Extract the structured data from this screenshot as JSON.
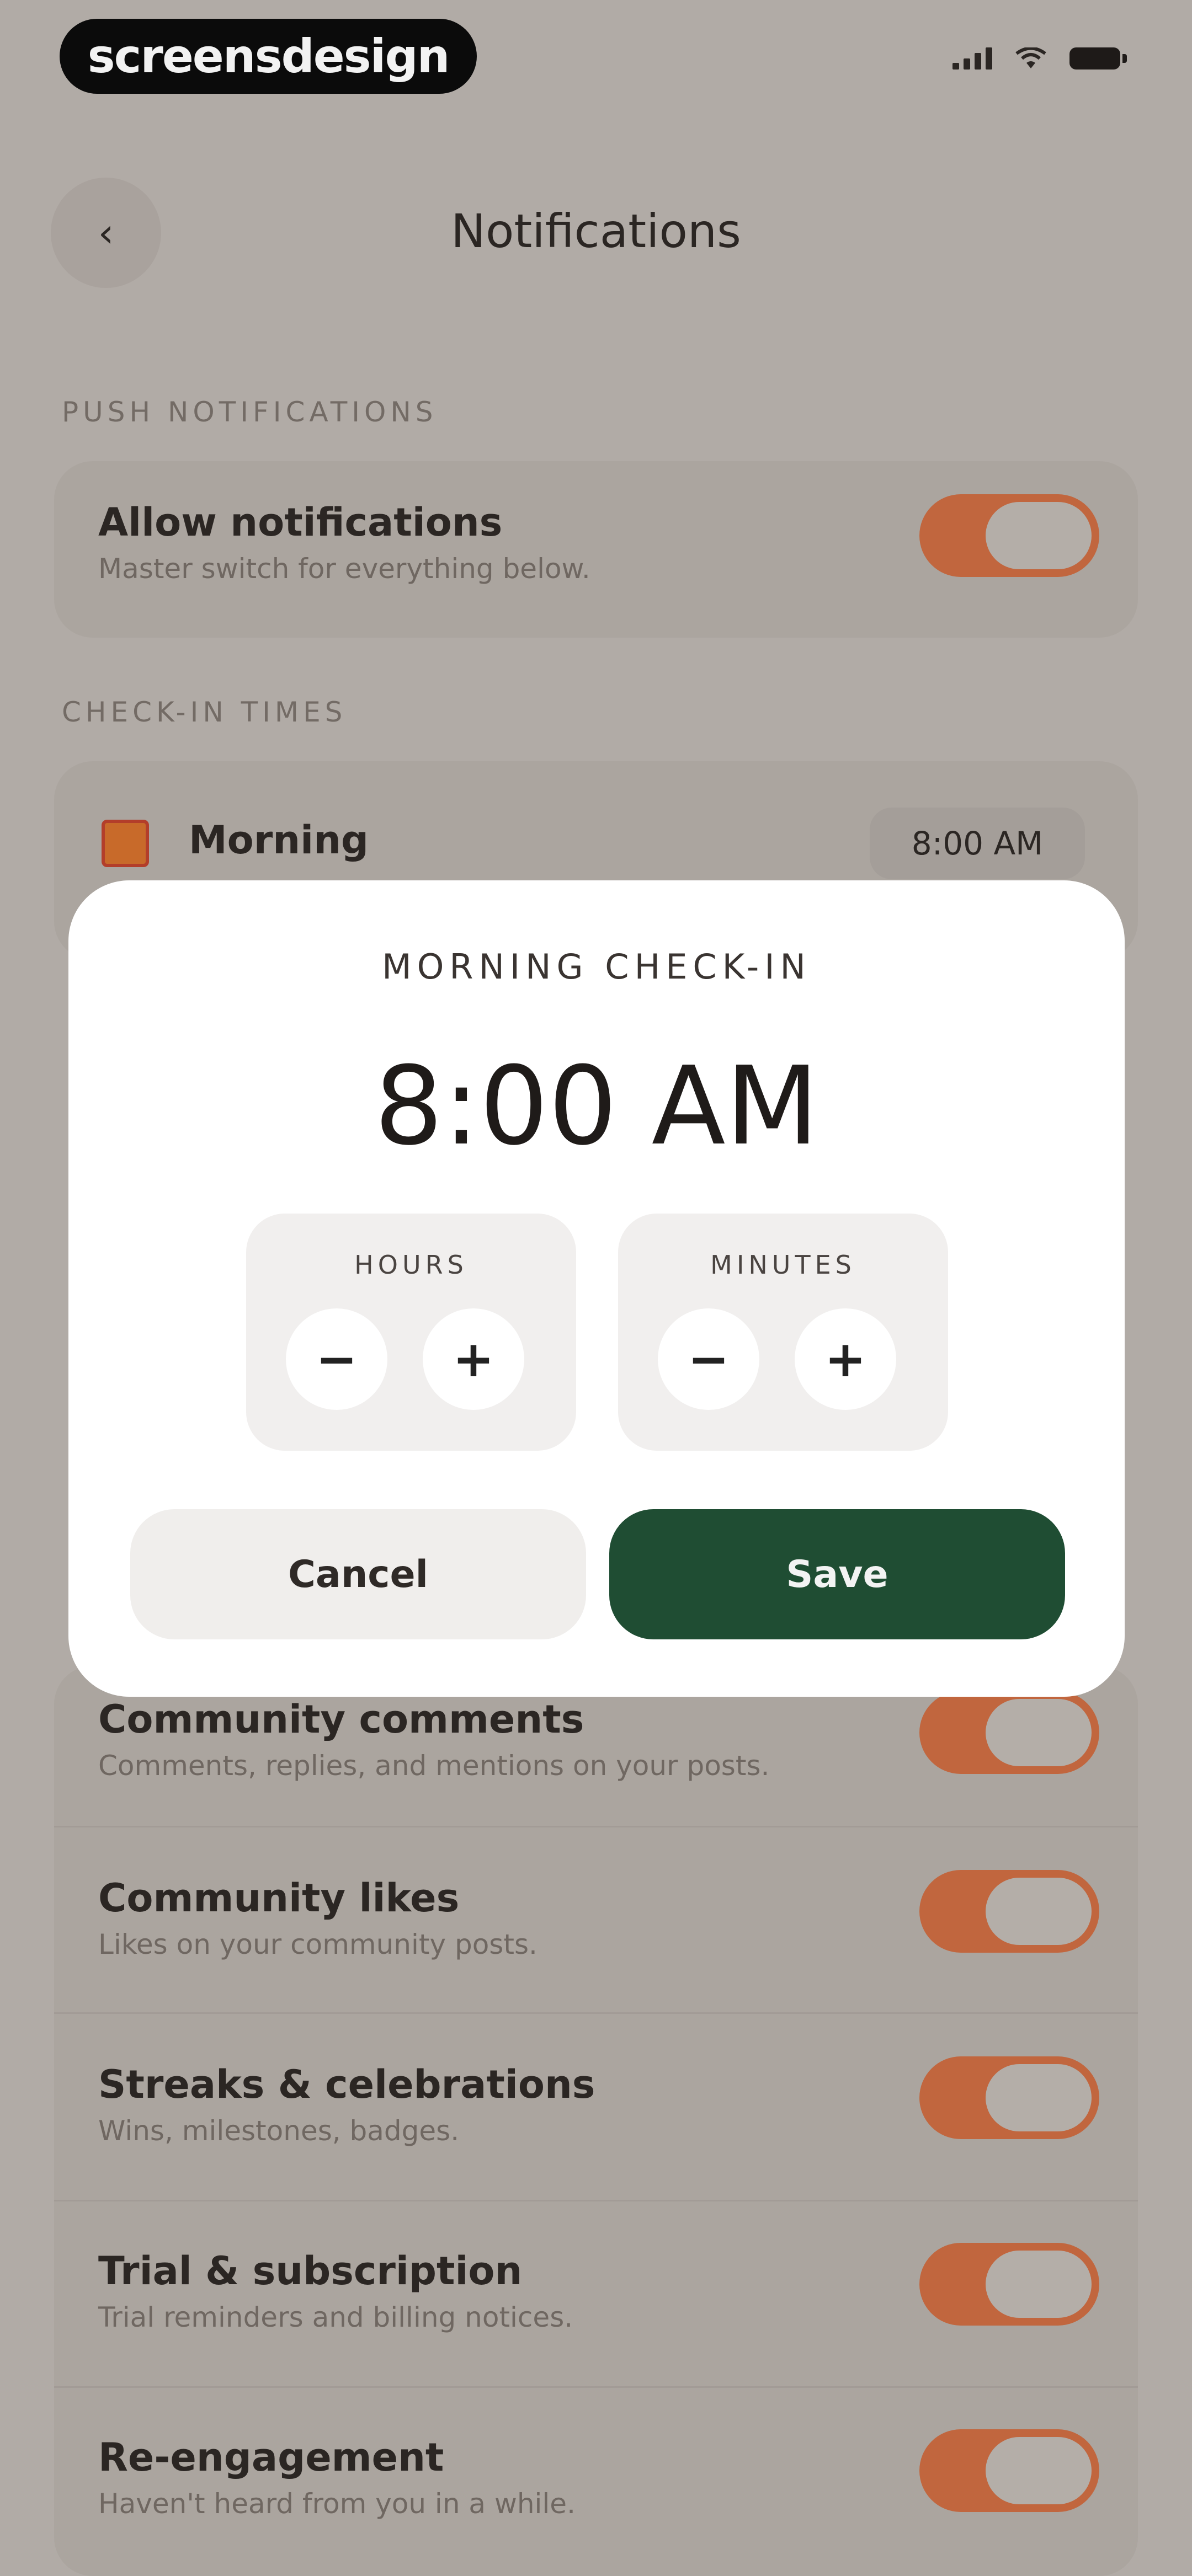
{
  "status_bar": {
    "brand": "screensdesign"
  },
  "header": {
    "back_glyph": "‹",
    "title": "Notifications"
  },
  "sections": {
    "push": {
      "label": "PUSH NOTIFICATIONS",
      "allow": {
        "title": "Allow notifications",
        "subtitle": "Master switch for everything below.",
        "enabled": true
      }
    },
    "checkin": {
      "label": "CHECK-IN TIMES",
      "morning": {
        "icon": "sunrise-icon",
        "title": "Morning",
        "time": "8:00 AM"
      }
    },
    "list": [
      {
        "title": "Community comments",
        "subtitle": "Comments, replies, and mentions on your posts.",
        "enabled": true
      },
      {
        "title": "Community likes",
        "subtitle": "Likes on your community posts.",
        "enabled": true
      },
      {
        "title": "Streaks & celebrations",
        "subtitle": "Wins, milestones, badges.",
        "enabled": true
      },
      {
        "title": "Trial & subscription",
        "subtitle": "Trial reminders and billing notices.",
        "enabled": true
      },
      {
        "title": "Re-engagement",
        "subtitle": "Haven't heard from you in a while.",
        "enabled": true
      }
    ]
  },
  "modal": {
    "label": "MORNING CHECK-IN",
    "time": "8:00 AM",
    "hours": {
      "label": "HOURS",
      "minus": "−",
      "plus": "+"
    },
    "minutes": {
      "label": "MINUTES",
      "minus": "−",
      "plus": "+"
    },
    "cancel_label": "Cancel",
    "save_label": "Save"
  },
  "colors": {
    "accent_toggle": "#c1663e",
    "save_button": "#1f4d33"
  }
}
